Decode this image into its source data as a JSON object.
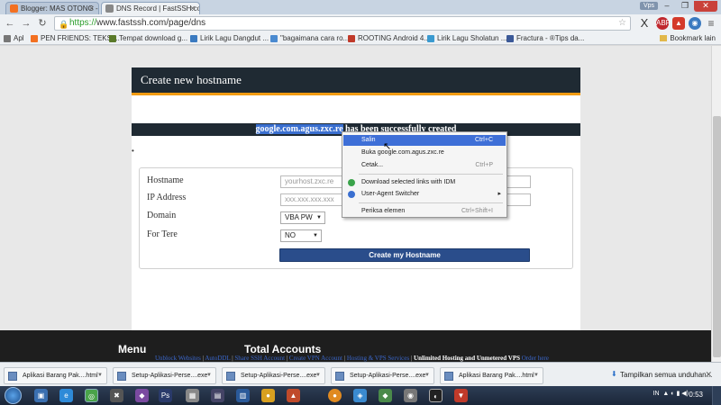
{
  "browser": {
    "tabs": [
      {
        "title": "Blogger: MAS OTONG - B",
        "color": "#f37021",
        "active": false
      },
      {
        "title": "DNS Record | FastSSH.com",
        "color": "#888888",
        "active": true
      }
    ],
    "vps_label": "Vps",
    "url_scheme": "https://",
    "url_rest": "www.fastssh.com/page/dns",
    "bookmarks": [
      {
        "label": "Apl",
        "color": "#777777"
      },
      {
        "label": "PEN FRIENDS: TEKS ...",
        "color": "#f37021"
      },
      {
        "label": "Tempat download g...",
        "color": "#5a7a2a"
      },
      {
        "label": "Lirik Lagu Dangdut ...",
        "color": "#3a7ac0"
      },
      {
        "label": "\"bagaimana cara ro...",
        "color": "#4a8ad0"
      },
      {
        "label": "ROOTING Android 4...",
        "color": "#c03a2a"
      },
      {
        "label": "Lirik Lagu Sholatun ...",
        "color": "#3a9ad0"
      },
      {
        "label": "Fractura - ®Tips da...",
        "color": "#3b5998"
      }
    ],
    "bookmarks_other": "Bookmark lain"
  },
  "page": {
    "card_title": "Create new hostname",
    "success_selected": "google.com.agus.zxc.re",
    "success_rest": " has been successfully created",
    "form": {
      "hostname_label": "Hostname",
      "hostname_placeholder": "yourhost.zxc.re",
      "ip_label": "IP Address",
      "ip_placeholder": "xxx.xxx.xxx.xxx",
      "domain_label": "Domain",
      "domain_value": "VBA PW",
      "fortere_label": "For Tere",
      "fortere_value": "NO",
      "create_button": "Create my Hostname"
    }
  },
  "context_menu": {
    "items": [
      {
        "label": "Salin",
        "shortcut": "Ctrl+C",
        "highlighted": true
      },
      {
        "label": "Buka google.com.agus.zxc.re",
        "shortcut": ""
      },
      {
        "label": "Cetak...",
        "shortcut": "Ctrl+P"
      },
      {
        "label": "Download selected links with IDM",
        "shortcut": ""
      },
      {
        "label": "User-Agent Switcher",
        "shortcut": ""
      },
      {
        "label": "Periksa elemen",
        "shortcut": "Ctrl+Shift+I"
      }
    ]
  },
  "footer": {
    "menu_heading": "Menu",
    "accounts_heading": "Total Accounts",
    "links": [
      "Unblock Websites",
      "AutoDDL",
      "Share SSH Account",
      "Create VPN Account",
      "Hosting & VPS Services"
    ],
    "bold_text": "Unlimited Hosting and Unmetered VPS",
    "order_link": "Order here",
    "separator": " | "
  },
  "downloads": {
    "items": [
      "Aplikasi Barang Pak....html",
      "Setup-Aplikasi-Perse....exe",
      "Setup-Aplikasi-Perse....exe",
      "Setup-Aplikasi-Perse....exe",
      "Aplikasi Barang Pak....html"
    ],
    "show_all": "Tampilkan semua unduhan..."
  },
  "taskbar": {
    "lang": "IN",
    "time": "0:53"
  }
}
